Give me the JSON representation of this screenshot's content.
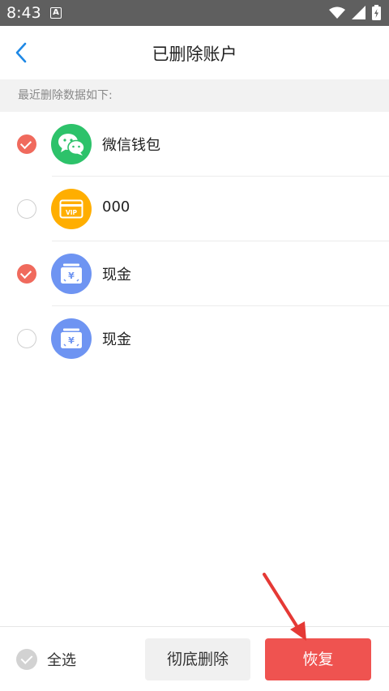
{
  "status_bar": {
    "time": "8:43",
    "notification_badge": "A"
  },
  "header": {
    "title": "已删除账户",
    "back_icon": "chevron-left-icon"
  },
  "section": {
    "header": "最近删除数据如下:"
  },
  "accounts": [
    {
      "name": "微信钱包",
      "icon": "wechat-icon",
      "icon_color": "#2dc26a",
      "checked": true
    },
    {
      "name": "000",
      "icon": "vip-card-icon",
      "icon_color": "#ffae00",
      "checked": false
    },
    {
      "name": "现金",
      "icon": "cash-icon",
      "icon_color": "#6e94f2",
      "checked": true
    },
    {
      "name": "现金",
      "icon": "cash-icon",
      "icon_color": "#6e94f2",
      "checked": false
    }
  ],
  "footer": {
    "select_all_label": "全选",
    "delete_label": "彻底删除",
    "restore_label": "恢复"
  },
  "colors": {
    "accent_red": "#ef5350",
    "check_red": "#f06a5d",
    "back_blue": "#1e88e5"
  }
}
